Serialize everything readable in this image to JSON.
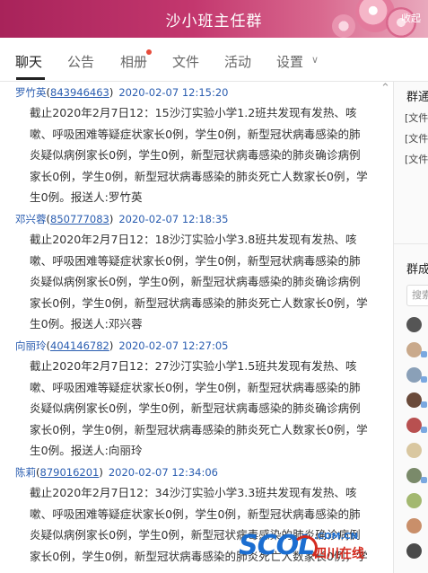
{
  "window": {
    "title": "沙小班主任群",
    "collapse": "收起"
  },
  "tabs": [
    {
      "label": "聊天"
    },
    {
      "label": "公告"
    },
    {
      "label": "相册"
    },
    {
      "label": "文件"
    },
    {
      "label": "活动"
    },
    {
      "label": "设置"
    }
  ],
  "messages": [
    {
      "sender": "罗竹英",
      "qq": "843946463",
      "time": "2020-02-07 12:15:20",
      "lines": [
        "截止2020年2月7日12：15沙汀实验小学1.2班共发现有发热、咳",
        "嗽、呼吸困难等疑症状家长0例，学生0例，新型冠状病毒感染的肺",
        "炎疑似病例家长0例，学生0例，新型冠状病毒感染的肺炎确诊病例",
        "家长0例，学生0例，新型冠状病毒感染的肺炎死亡人数家长0例，学",
        "生0例。报送人:罗竹英"
      ]
    },
    {
      "sender": "邓兴蓉",
      "qq": "850777083",
      "time": "2020-02-07 12:18:35",
      "lines": [
        "截止2020年2月7日12：18沙汀实验小学3.8班共发现有发热、咳",
        "嗽、呼吸困难等疑症状家长0例，学生0例，新型冠状病毒感染的肺",
        "炎疑似病例家长0例，学生0例，新型冠状病毒感染的肺炎确诊病例",
        "家长0例，学生0例，新型冠状病毒感染的肺炎死亡人数家长0例，学",
        "生0例。报送人:邓兴蓉"
      ]
    },
    {
      "sender": "向丽玲",
      "qq": "404146782",
      "time": "2020-02-07 12:27:05",
      "lines": [
        "截止2020年2月7日12：27沙汀实验小学1.5班共发现有发热、咳",
        "嗽、呼吸困难等疑症状家长0例，学生0例，新型冠状病毒感染的肺",
        "炎疑似病例家长0例，学生0例，新型冠状病毒感染的肺炎确诊病例",
        "家长0例，学生0例，新型冠状病毒感染的肺炎死亡人数家长0例，学",
        "生0例。报送人:向丽玲"
      ]
    },
    {
      "sender": "陈莉",
      "qq": "879016201",
      "time": "2020-02-07 12:34:06",
      "lines": [
        "截止2020年2月7日12：34沙汀实验小学3.3班共发现有发热、咳",
        "嗽、呼吸困难等疑症状家长0例，学生0例，新型冠状病毒感染的肺",
        "炎疑似病例家长0例，学生0例，新型冠状病毒感染的肺炎确诊病例",
        "家长0例，学生0例，新型冠状病毒感染的肺炎死亡人数家长0例，学"
      ]
    }
  ],
  "side": {
    "announce_title": "群通",
    "files": [
      "[文件",
      "[文件",
      "[文件"
    ],
    "members_title": "群成",
    "search_placeholder": "搜索"
  },
  "watermark": {
    "brand": "SCOL",
    "domain": ".COM.CN",
    "cn_name": "四川在线"
  }
}
